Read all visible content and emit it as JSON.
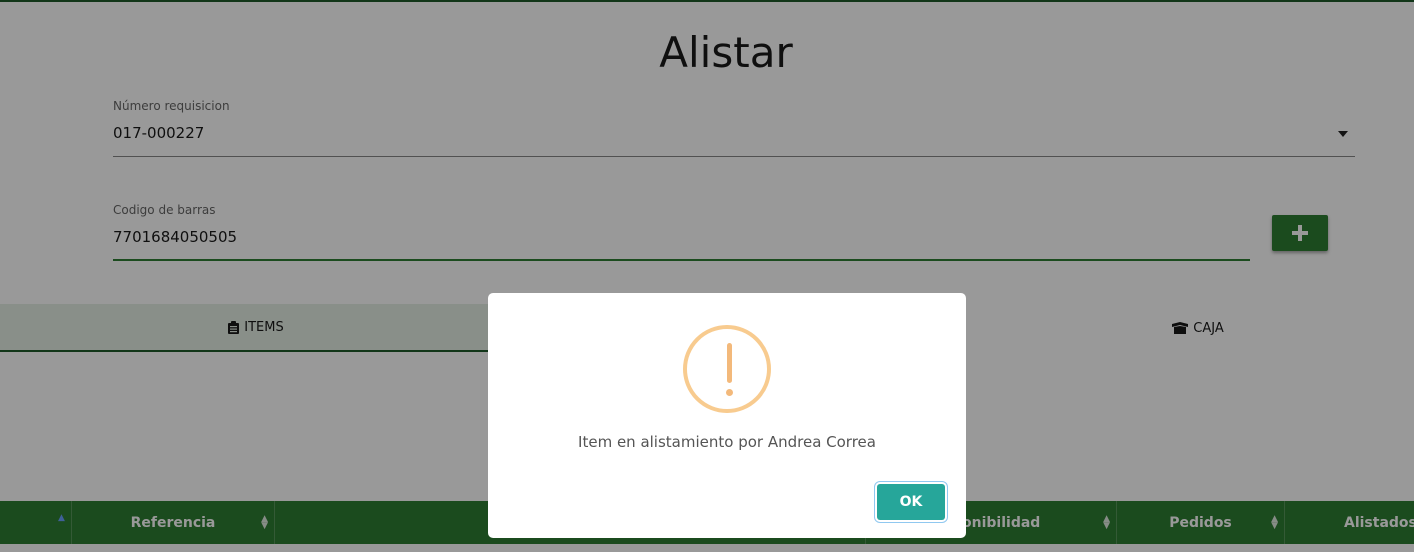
{
  "page": {
    "title": "Alistar"
  },
  "requisition": {
    "label": "Número requisicion",
    "value": "017-000227"
  },
  "barcode": {
    "label": "Codigo de barras",
    "value": "7701684050505"
  },
  "tabs": {
    "items_label": "ITEMS",
    "caja_label": "CAJA"
  },
  "table": {
    "headers": [
      "Referencia",
      "ponibilidad",
      "Pedidos",
      "Alistados"
    ]
  },
  "dialog": {
    "message": "Item en alistamiento por Andrea Correa",
    "ok_label": "OK"
  },
  "colors": {
    "primary": "#2e7d32",
    "ok_button": "#26a69a",
    "warning": "#f8bb86"
  },
  "icons": {
    "add": "plus-icon",
    "items": "clipboard-icon",
    "caja": "box-icon",
    "warning": "exclamation-icon",
    "sort": "sort-icon"
  }
}
